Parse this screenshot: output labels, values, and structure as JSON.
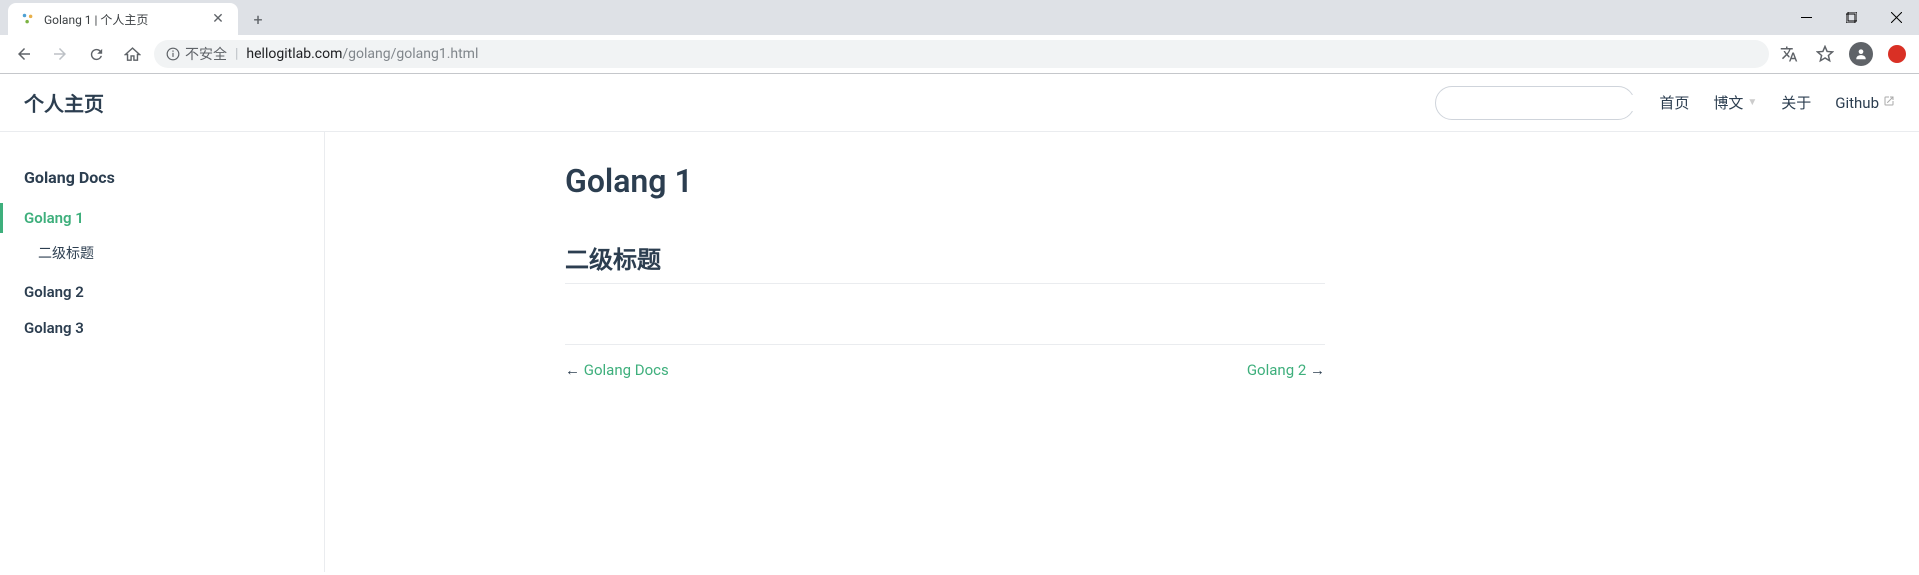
{
  "browser": {
    "tab_title": "Golang 1 | 个人主页",
    "security_label": "不安全",
    "url_host": "hellogitlab.com",
    "url_path": "/golang/golang1.html"
  },
  "navbar": {
    "site_title": "个人主页",
    "links": {
      "home": "首页",
      "blog": "博文",
      "about": "关于",
      "github": "Github"
    }
  },
  "sidebar": {
    "heading": "Golang Docs",
    "items": [
      {
        "label": "Golang 1",
        "active": true
      },
      {
        "label": "Golang 2",
        "active": false
      },
      {
        "label": "Golang 3",
        "active": false
      }
    ],
    "subitem": "二级标题"
  },
  "content": {
    "title": "Golang 1",
    "h2": "二级标题",
    "prev_label": "Golang Docs",
    "next_label": "Golang 2"
  }
}
